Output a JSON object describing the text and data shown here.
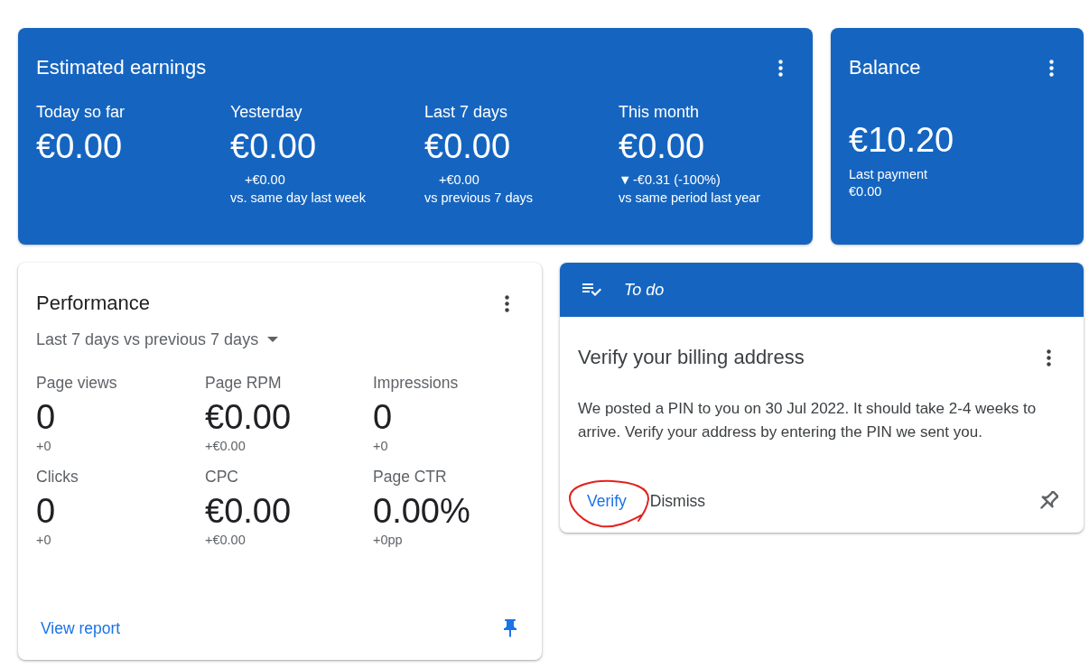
{
  "earnings": {
    "title": "Estimated earnings",
    "columns": [
      {
        "label": "Today so far",
        "value": "€0.00"
      },
      {
        "label": "Yesterday",
        "value": "€0.00",
        "change": {
          "text": "+€0.00"
        },
        "comparison": "vs. same day last week"
      },
      {
        "label": "Last 7 days",
        "value": "€0.00",
        "change": {
          "text": "+€0.00"
        },
        "comparison": "vs previous 7 days"
      },
      {
        "label": "This month",
        "value": "€0.00",
        "change": {
          "arrow": "▼",
          "text": "-€0.31 (-100%)"
        },
        "comparison": "vs same period last year"
      }
    ]
  },
  "balance": {
    "title": "Balance",
    "value": "€10.20",
    "last_payment_label": "Last payment",
    "last_payment_value": "€0.00"
  },
  "performance": {
    "title": "Performance",
    "range": "Last 7 days vs previous 7 days",
    "metrics": [
      {
        "label": "Page views",
        "value": "0",
        "change": "+0"
      },
      {
        "label": "Page RPM",
        "value": "€0.00",
        "change": "+€0.00"
      },
      {
        "label": "Impressions",
        "value": "0",
        "change": "+0"
      },
      {
        "label": "Clicks",
        "value": "0",
        "change": "+0"
      },
      {
        "label": "CPC",
        "value": "€0.00",
        "change": "+€0.00"
      },
      {
        "label": "Page CTR",
        "value": "0.00%",
        "change": "+0pp"
      }
    ],
    "link": "View report",
    "pinned": true
  },
  "todo": {
    "header": "To do",
    "title": "Verify your billing address",
    "message": "We posted a PIN to you on 30 Jul 2022. It should take 2-4 weeks to arrive. Verify your address by entering the PIN we sent you.",
    "actions": [
      {
        "label": "Verify",
        "kind": "primary",
        "circled": true
      },
      {
        "label": "Dismiss",
        "kind": "secondary",
        "circled": false
      }
    ],
    "pinned": false
  }
}
